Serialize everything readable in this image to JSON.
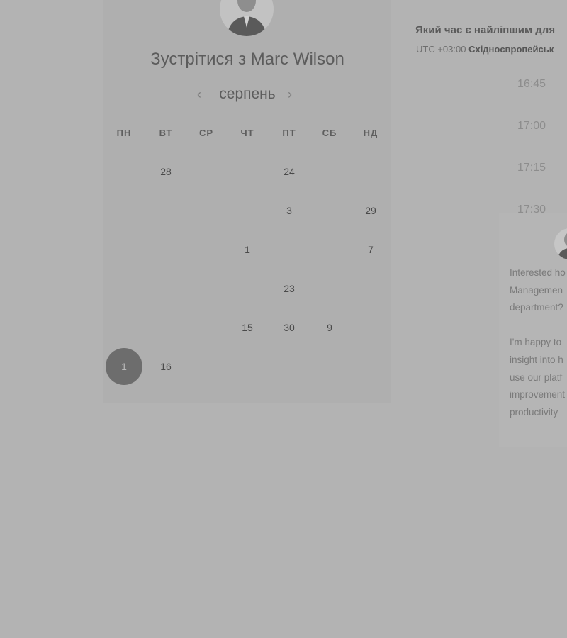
{
  "calendar": {
    "title": "Зустрітися з Marc Wilson",
    "month": "серпень",
    "prev_label": "‹",
    "next_label": "›",
    "weekdays": [
      "ПН",
      "ВТ",
      "СР",
      "ЧТ",
      "ПТ",
      "СБ",
      "НД"
    ],
    "rows": [
      [
        "",
        "28",
        "",
        "",
        "24",
        "",
        ""
      ],
      [
        "",
        "",
        "",
        "",
        "3",
        "",
        "29"
      ],
      [
        "",
        "",
        "",
        "1",
        "",
        "",
        "7"
      ],
      [
        "",
        "",
        "",
        "",
        "23",
        "",
        ""
      ],
      [
        "",
        "",
        "",
        "15",
        "30",
        "9",
        ""
      ],
      [
        "1",
        "16",
        "",
        "",
        "",
        "",
        ""
      ]
    ],
    "disabled_marks": "",
    "selected_day": "1"
  },
  "right": {
    "title": "Який час є найліпшим для",
    "tz_prefix": "UTC +03:00",
    "tz_name": "Східноєвропейськ",
    "times": [
      "16:45",
      "17:00",
      "17:15",
      "17:30"
    ],
    "card_text": "Interested ho\nManagemen\ndepartment?\n\nI'm happy to\ninsight into h\nuse our platf\nimprovement\nproductivity"
  },
  "colors": {
    "backdrop": "#b3b3b3",
    "selected_day": "#6d6d6d"
  }
}
